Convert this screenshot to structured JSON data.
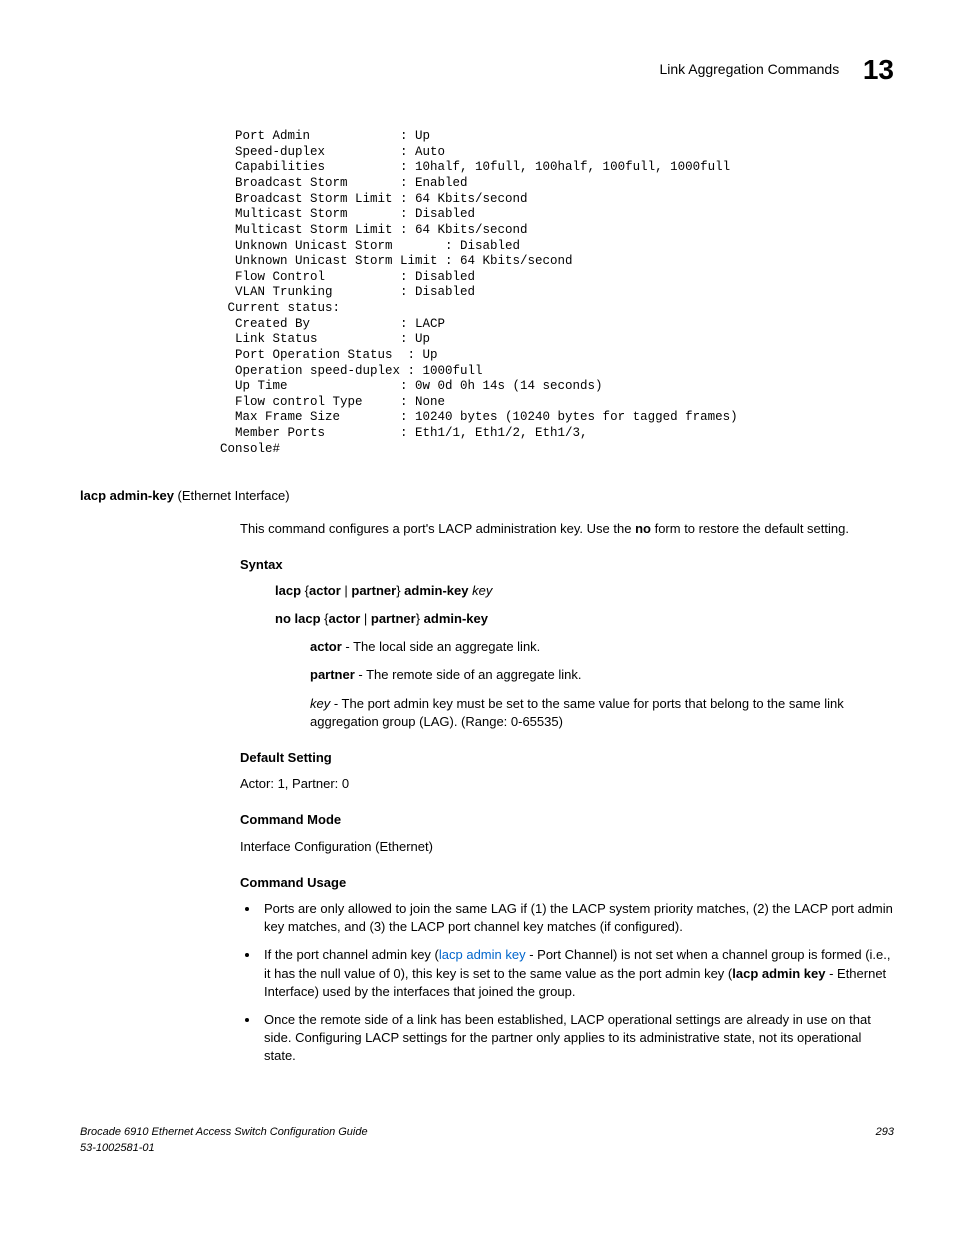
{
  "header": {
    "title": "Link Aggregation Commands",
    "chapter": "13"
  },
  "console": "  Port Admin            : Up\n  Speed-duplex          : Auto\n  Capabilities          : 10half, 10full, 100half, 100full, 1000full\n  Broadcast Storm       : Enabled\n  Broadcast Storm Limit : 64 Kbits/second\n  Multicast Storm       : Disabled\n  Multicast Storm Limit : 64 Kbits/second\n  Unknown Unicast Storm       : Disabled\n  Unknown Unicast Storm Limit : 64 Kbits/second\n  Flow Control          : Disabled\n  VLAN Trunking         : Disabled\n Current status:\n  Created By            : LACP\n  Link Status           : Up\n  Port Operation Status  : Up\n  Operation speed-duplex : 1000full\n  Up Time               : 0w 0d 0h 14s (14 seconds)\n  Flow control Type     : None\n  Max Frame Size        : 10240 bytes (10240 bytes for tagged frames)\n  Member Ports          : Eth1/1, Eth1/2, Eth1/3,\nConsole#",
  "cmd": {
    "name_bold": "lacp admin-key",
    "name_rest": " (Ethernet Interface)",
    "description_pre": "This command configures a port's LACP administration key. Use the ",
    "description_bold": "no",
    "description_post": " form to restore the default setting."
  },
  "syntax": {
    "heading": "Syntax",
    "line1_b1": "lacp",
    "line1_t1": " {",
    "line1_b2": "actor",
    "line1_t2": " | ",
    "line1_b3": "partner",
    "line1_t3": "} ",
    "line1_b4": "admin-key",
    "line1_t4": " ",
    "line1_i1": "key",
    "line2_b1": "no lacp",
    "line2_t1": " {",
    "line2_b2": "actor",
    "line2_t2": " | ",
    "line2_b3": "partner",
    "line2_t3": "} ",
    "line2_b4": "admin-key",
    "p_actor_b": "actor",
    "p_actor_t": " - The local side an aggregate link.",
    "p_partner_b": "partner",
    "p_partner_t": " - The remote side of an aggregate link.",
    "p_key_i": "key",
    "p_key_t": " - The port admin key must be set to the same value for ports that belong to the same link aggregation group (LAG). (Range: 0-65535)"
  },
  "default": {
    "heading": "Default Setting",
    "text": "Actor: 1, Partner: 0"
  },
  "mode": {
    "heading": "Command Mode",
    "text": "Interface Configuration (Ethernet)"
  },
  "usage": {
    "heading": "Command Usage",
    "item1": "Ports are only allowed to join the same LAG if (1) the LACP system priority matches, (2) the LACP port admin key matches, and (3) the LACP port channel key matches (if configured).",
    "item2_pre": "If the port channel admin key (",
    "item2_link": "lacp admin key",
    "item2_mid": " - Port Channel) is not set when a channel group is formed (i.e., it has the null value of 0), this key is set to the same value as the port admin key (",
    "item2_b": "lacp admin key",
    "item2_post": " - Ethernet Interface) used by the interfaces that joined the group.",
    "item3": "Once the remote side of a link has been established, LACP operational settings are already in use on that side. Configuring LACP settings for the partner only applies to its administrative state, not its operational state."
  },
  "footer": {
    "left1": "Brocade 6910 Ethernet Access Switch Configuration Guide",
    "left2": "53-1002581-01",
    "right": "293"
  }
}
